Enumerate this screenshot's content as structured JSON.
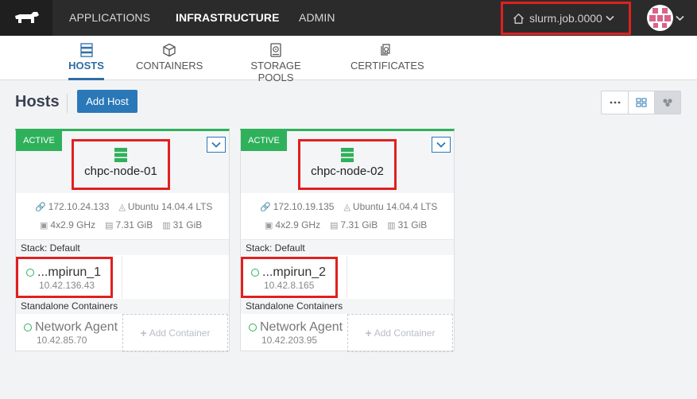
{
  "topnav": {
    "items": [
      {
        "label": "APPLICATIONS",
        "active": false
      },
      {
        "label": "INFRASTRUCTURE",
        "active": true
      },
      {
        "label": "ADMIN",
        "active": false
      }
    ],
    "environment": "slurm.job.0000"
  },
  "subnav": {
    "tabs": [
      {
        "label": "HOSTS",
        "icon": "hosts-icon",
        "active": true
      },
      {
        "label": "CONTAINERS",
        "icon": "container-box-icon",
        "active": false
      },
      {
        "label": "STORAGE POOLS",
        "icon": "storage-icon",
        "active": false
      },
      {
        "label": "CERTIFICATES",
        "icon": "certificate-icon",
        "active": false
      }
    ]
  },
  "page": {
    "title": "Hosts",
    "add_host_label": "Add Host"
  },
  "colors": {
    "active_green": "#2fb15b",
    "accent_blue": "#2a78b7",
    "highlight_red": "#e02020"
  },
  "hosts": [
    {
      "state": "ACTIVE",
      "name": "chpc-node-01",
      "ip": "172.10.24.133",
      "os": "Ubuntu 14.04.4 LTS",
      "cpu": "4x2.9 GHz",
      "memory": "7.31 GiB",
      "storage": "31 GiB",
      "stack_label": "Stack: Default",
      "stack_container": {
        "name": "...mpirun_1",
        "ip": "10.42.136.43"
      },
      "standalone_label": "Standalone Containers",
      "agent": {
        "name": "Network Agent",
        "ip": "10.42.85.70"
      },
      "add_container_label": "Add Container"
    },
    {
      "state": "ACTIVE",
      "name": "chpc-node-02",
      "ip": "172.10.19.135",
      "os": "Ubuntu 14.04.4 LTS",
      "cpu": "4x2.9 GHz",
      "memory": "7.31 GiB",
      "storage": "31 GiB",
      "stack_label": "Stack: Default",
      "stack_container": {
        "name": "...mpirun_2",
        "ip": "10.42.8.165"
      },
      "standalone_label": "Standalone Containers",
      "agent": {
        "name": "Network Agent",
        "ip": "10.42.203.95"
      },
      "add_container_label": "Add Container"
    }
  ]
}
